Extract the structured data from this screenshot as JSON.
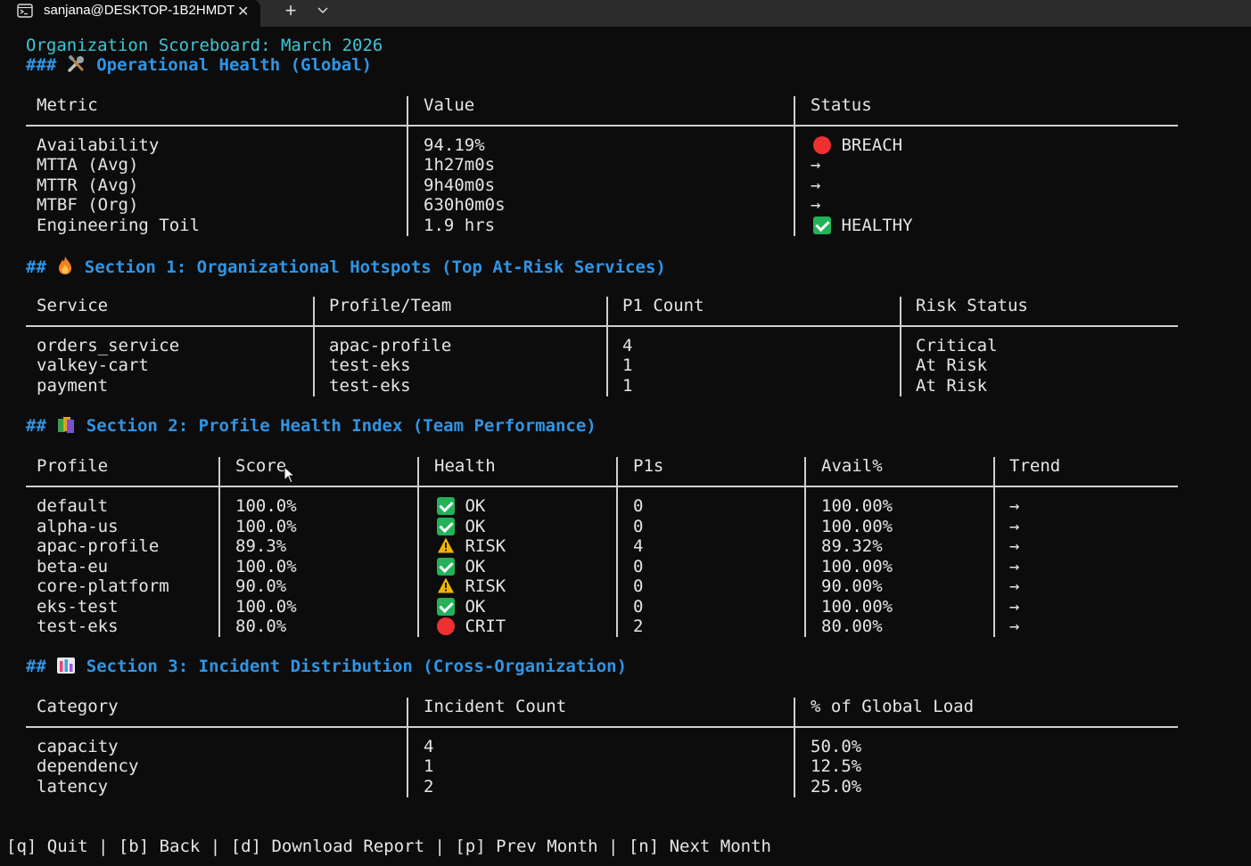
{
  "window": {
    "tab_title": "sanjana@DESKTOP-1B2HMDT",
    "tab_icon": "terminal-icon",
    "close_glyph": "✕",
    "new_tab_glyph": "+",
    "dropdown_glyph": "⌄"
  },
  "report": {
    "title": "Organization Scoreboard: March 2026",
    "ops_heading_prefix": "###",
    "ops_heading_text": "Operational Health (Global)",
    "ops_table": {
      "headers": [
        "Metric",
        "Value",
        "Status"
      ],
      "rows": [
        {
          "metric": "Availability",
          "value": "94.19%",
          "status_icon": "red-circle",
          "status": "BREACH"
        },
        {
          "metric": "MTTA (Avg)",
          "value": "1h27m0s",
          "status_icon": "",
          "status": "→"
        },
        {
          "metric": "MTTR (Avg)",
          "value": "9h40m0s",
          "status_icon": "",
          "status": "→"
        },
        {
          "metric": "MTBF (Org)",
          "value": "630h0m0s",
          "status_icon": "",
          "status": "→"
        },
        {
          "metric": "Engineering Toil",
          "value": "1.9 hrs",
          "status_icon": "check",
          "status": "HEALTHY"
        }
      ]
    },
    "section1": {
      "prefix": "##",
      "heading": "Section 1: Organizational Hotspots (Top At-Risk Services)",
      "headers": [
        "Service",
        "Profile/Team",
        "P1 Count",
        "Risk Status"
      ],
      "rows": [
        {
          "service": "orders_service",
          "team": "apac-profile",
          "p1": "4",
          "risk": "Critical"
        },
        {
          "service": "valkey-cart",
          "team": "test-eks",
          "p1": "1",
          "risk": "At Risk"
        },
        {
          "service": "payment",
          "team": "test-eks",
          "p1": "1",
          "risk": "At Risk"
        }
      ]
    },
    "section2": {
      "prefix": "##",
      "heading": "Section 2: Profile Health Index (Team Performance)",
      "headers": [
        "Profile",
        "Score",
        "Health",
        "P1s",
        "Avail%",
        "Trend"
      ],
      "rows": [
        {
          "profile": "default",
          "score": "100.0%",
          "health_icon": "check",
          "health": "OK",
          "p1s": "0",
          "avail": "100.00%",
          "trend": "→"
        },
        {
          "profile": "alpha-us",
          "score": "100.0%",
          "health_icon": "check",
          "health": "OK",
          "p1s": "0",
          "avail": "100.00%",
          "trend": "→"
        },
        {
          "profile": "apac-profile",
          "score": "89.3%",
          "health_icon": "warning",
          "health": "RISK",
          "p1s": "4",
          "avail": "89.32%",
          "trend": "→"
        },
        {
          "profile": "beta-eu",
          "score": "100.0%",
          "health_icon": "check",
          "health": "OK",
          "p1s": "0",
          "avail": "100.00%",
          "trend": "→"
        },
        {
          "profile": "core-platform",
          "score": "90.0%",
          "health_icon": "warning",
          "health": "RISK",
          "p1s": "0",
          "avail": "90.00%",
          "trend": "→"
        },
        {
          "profile": "eks-test",
          "score": "100.0%",
          "health_icon": "check",
          "health": "OK",
          "p1s": "0",
          "avail": "100.00%",
          "trend": "→"
        },
        {
          "profile": "test-eks",
          "score": "80.0%",
          "health_icon": "red-circle",
          "health": "CRIT",
          "p1s": "2",
          "avail": "80.00%",
          "trend": "→"
        }
      ]
    },
    "section3": {
      "prefix": "##",
      "heading": "Section 3: Incident Distribution (Cross-Organization)",
      "headers": [
        "Category",
        "Incident Count",
        "% of Global Load"
      ],
      "rows": [
        {
          "category": "capacity",
          "count": "4",
          "pct": "50.0%"
        },
        {
          "category": "dependency",
          "count": "1",
          "pct": "12.5%"
        },
        {
          "category": "latency",
          "count": "2",
          "pct": "25.0%"
        }
      ]
    }
  },
  "footer": {
    "quit": "[q] Quit",
    "back": "[b] Back",
    "download": "[d] Download Report",
    "prev": "[p] Prev Month",
    "next": "[n] Next Month",
    "separator": " | "
  },
  "colors": {
    "title": "#3dc7d6",
    "heading": "#2f95e6",
    "text": "#e6e6e6",
    "background": "#0c0c0c",
    "ok": "#23b25a",
    "crit": "#f03030",
    "warn": "#f0b400"
  }
}
